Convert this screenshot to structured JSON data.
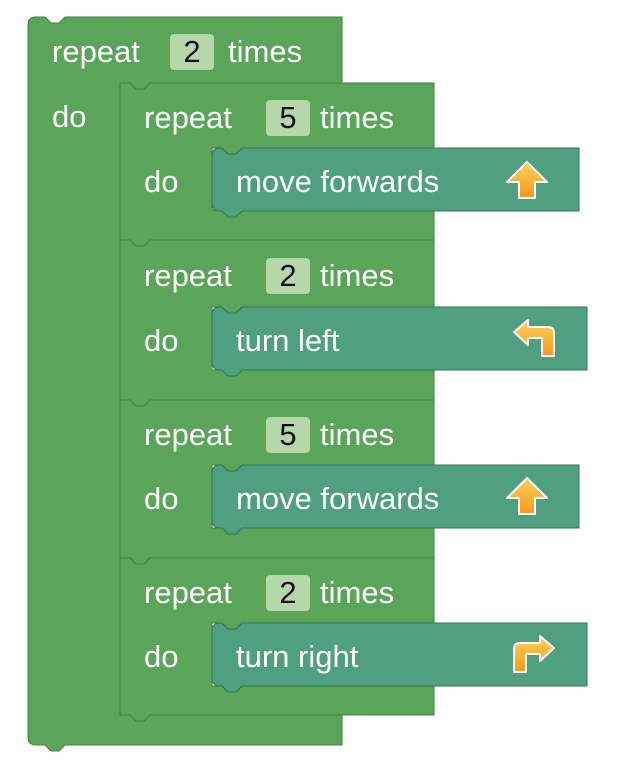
{
  "program": {
    "outer_loop": {
      "repeat_label": "repeat",
      "count": "2",
      "times_label": "times",
      "do_label": "do"
    },
    "inner_loops": [
      {
        "repeat_label": "repeat",
        "count": "5",
        "times_label": "times",
        "do_label": "do",
        "action": {
          "label": "move forwards",
          "icon": "arrow-up-icon"
        }
      },
      {
        "repeat_label": "repeat",
        "count": "2",
        "times_label": "times",
        "do_label": "do",
        "action": {
          "label": "turn left",
          "icon": "turn-left-icon"
        }
      },
      {
        "repeat_label": "repeat",
        "count": "5",
        "times_label": "times",
        "do_label": "do",
        "action": {
          "label": "move forwards",
          "icon": "arrow-up-icon"
        }
      },
      {
        "repeat_label": "repeat",
        "count": "2",
        "times_label": "times",
        "do_label": "do",
        "action": {
          "label": "turn right",
          "icon": "turn-right-icon"
        }
      }
    ]
  },
  "colors": {
    "loop_block": "#5ba55b",
    "loop_block_highlight": "#75b975",
    "loop_block_shadow": "#3f803f",
    "action_block": "#4f9f80",
    "action_block_highlight": "#6fb99a",
    "action_block_shadow": "#36735b",
    "number_field": "#b5d7a9",
    "icon_fill": "#f8b33a",
    "icon_stroke": "#ffffff"
  }
}
